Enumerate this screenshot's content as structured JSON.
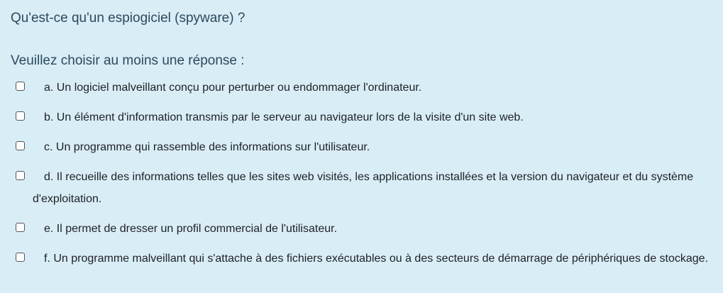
{
  "question": {
    "text": "Qu'est-ce qu'un espiogiciel (spyware) ?",
    "prompt": "Veuillez choisir au moins une réponse :"
  },
  "answers": [
    {
      "text": "a. Un logiciel malveillant conçu pour perturber ou endommager l'ordinateur.",
      "checked": false
    },
    {
      "text": "b. Un élément d'information transmis par le serveur au navigateur lors de la visite d'un site web.",
      "checked": false
    },
    {
      "text": "c. Un programme qui rassemble des informations sur l'utilisateur.",
      "checked": false
    },
    {
      "text": "d. Il recueille des informations telles que les sites web visités, les applications installées et la version du navigateur et du système d'exploitation.",
      "checked": false
    },
    {
      "text": "e. Il permet de dresser un profil commercial de l'utilisateur.",
      "checked": false
    },
    {
      "text": "f. Un programme malveillant qui s'attache à des fichiers exécutables ou à des secteurs de démarrage de périphériques de stockage.",
      "checked": false
    }
  ]
}
